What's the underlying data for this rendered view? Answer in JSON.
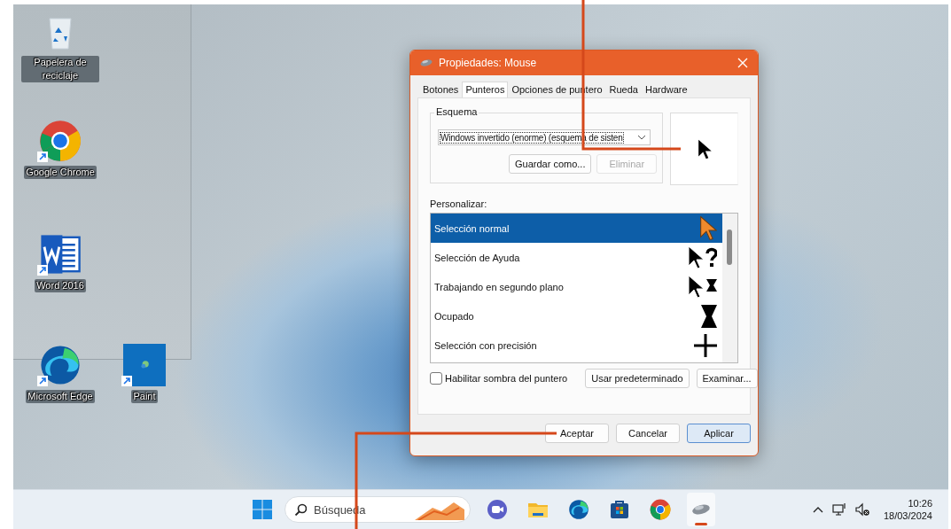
{
  "desktop_icons": [
    {
      "label": "Papelera de reciclaje",
      "kind": "recycle"
    },
    {
      "label": "Google Chrome",
      "kind": "chrome"
    },
    {
      "label": "Word 2016",
      "kind": "word"
    },
    {
      "label": "Microsoft Edge",
      "kind": "edge"
    },
    {
      "label": "Paint",
      "kind": "paint"
    }
  ],
  "dialog": {
    "title": "Propiedades: Mouse",
    "tabs": [
      {
        "label": "Botones",
        "selected": false
      },
      {
        "label": "Punteros",
        "selected": true
      },
      {
        "label": "Opciones de puntero",
        "selected": false
      },
      {
        "label": "Rueda",
        "selected": false
      },
      {
        "label": "Hardware",
        "selected": false
      }
    ],
    "scheme": {
      "label": "Esquema",
      "value": "Windows invertido (enorme) (esquema de sisten",
      "buttons": [
        {
          "label": "Guardar como...",
          "disabled": false
        },
        {
          "label": "Eliminar",
          "disabled": true
        }
      ]
    },
    "customize_label": "Personalizar:",
    "cursors": [
      {
        "label": "Selección normal",
        "kind": "arrow",
        "selected": true
      },
      {
        "label": "Selección de Ayuda",
        "kind": "help",
        "selected": false
      },
      {
        "label": "Trabajando en segundo plano",
        "kind": "working",
        "selected": false
      },
      {
        "label": "Ocupado",
        "kind": "busy",
        "selected": false
      },
      {
        "label": "Selección con precisión",
        "kind": "cross",
        "selected": false
      }
    ],
    "shadow_checkbox": {
      "label": "Habilitar sombra del puntero",
      "checked": false
    },
    "side_buttons": [
      "Usar predeterminado",
      "Examinar..."
    ],
    "footer_buttons": [
      {
        "label": "Aceptar",
        "default": false
      },
      {
        "label": "Cancelar",
        "default": false
      },
      {
        "label": "Aplicar",
        "default": true
      }
    ]
  },
  "taskbar": {
    "search": {
      "placeholder": "Búsqueda"
    },
    "apps": [
      {
        "kind": "meet",
        "active": false
      },
      {
        "kind": "folder",
        "active": false
      },
      {
        "kind": "edge",
        "active": false
      },
      {
        "kind": "store",
        "active": false
      },
      {
        "kind": "chrome",
        "active": false
      },
      {
        "kind": "mouse",
        "active": true
      }
    ],
    "time": "10:26",
    "date": "18/03/2024"
  }
}
